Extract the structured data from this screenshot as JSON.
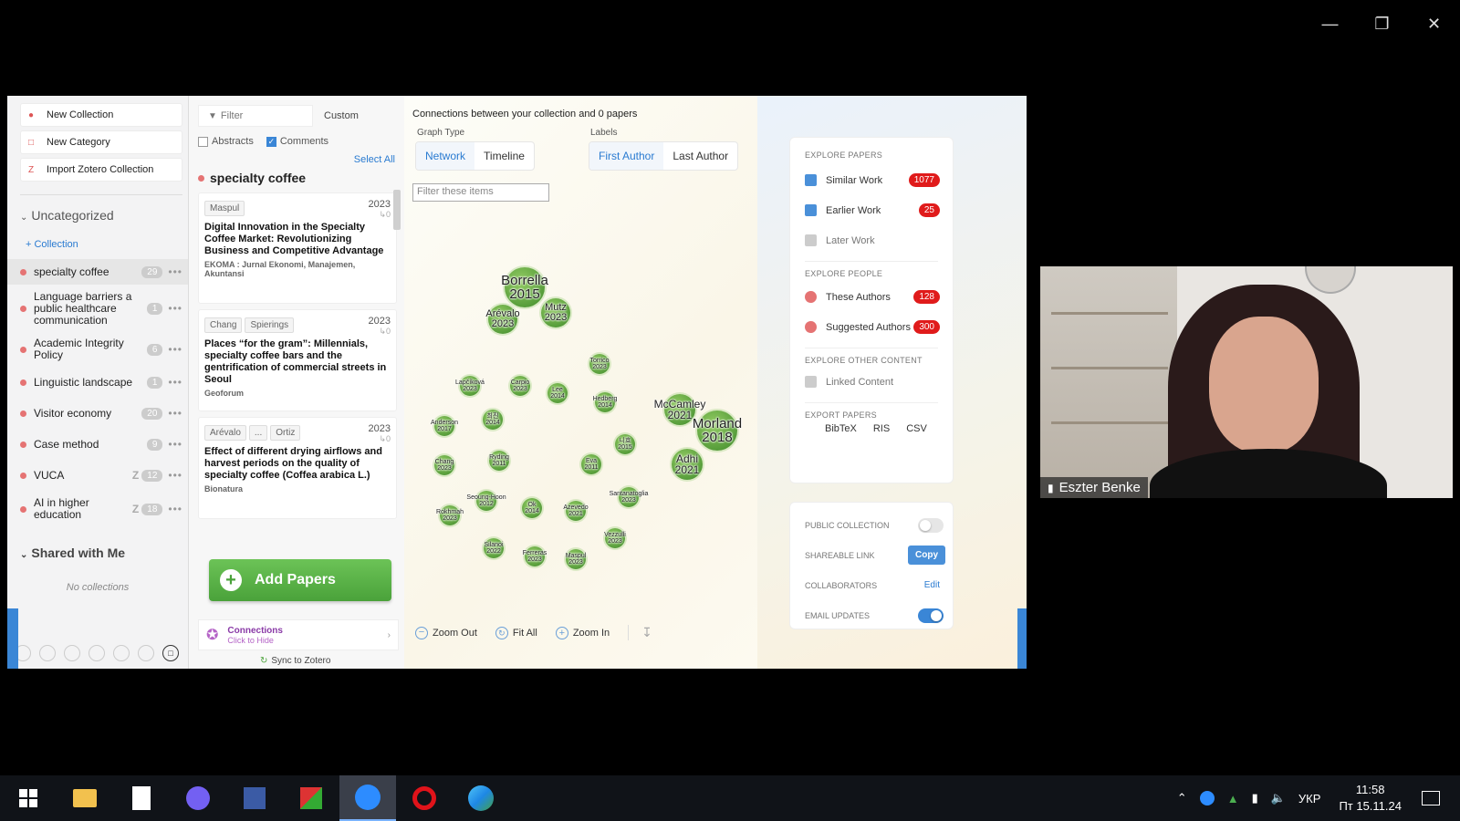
{
  "sidebar": {
    "buttons": [
      "New Collection",
      "New Category",
      "Import Zotero Collection"
    ],
    "uncategorized_label": "Uncategorized",
    "add_collection": "+ Collection",
    "collections": [
      {
        "name": "specialty coffee",
        "count": "29"
      },
      {
        "name": "Language barriers a public healthcare communication",
        "count": "1"
      },
      {
        "name": "Academic Integrity Policy",
        "count": "6"
      },
      {
        "name": "Linguistic landscape",
        "count": "1"
      },
      {
        "name": "Visitor economy",
        "count": "20"
      },
      {
        "name": "Case method",
        "count": "9"
      },
      {
        "name": "VUCA",
        "count": "12",
        "z": "Z"
      },
      {
        "name": "AI in higher education",
        "count": "18",
        "z": "Z"
      }
    ],
    "shared_label": "Shared with Me",
    "no_collections": "No collections"
  },
  "list": {
    "filter_placeholder": "Filter",
    "custom_label": "Custom",
    "abstracts_label": "Abstracts",
    "comments_label": "Comments",
    "select_all": "Select All",
    "collection_title": "specialty coffee",
    "papers": [
      {
        "tags": [
          "Maspul"
        ],
        "year": "2023",
        "cites": "↳0",
        "title": "Digital Innovation in the Specialty Coffee Market: Revolutionizing Business and Competitive Advantage",
        "journal": "EKOMA : Jurnal Ekonomi, Manajemen, Akuntansi"
      },
      {
        "tags": [
          "Chang",
          "Spierings"
        ],
        "year": "2023",
        "cites": "↳0",
        "title": "Places “for the gram”: Millennials, specialty coffee bars and the gentrification of commercial streets in Seoul",
        "journal": "Geoforum"
      },
      {
        "tags": [
          "Arévalo",
          "...",
          "Ortiz"
        ],
        "year": "2023",
        "cites": "↳0",
        "title": "Effect of different drying airflows and harvest periods on the quality of specialty coffee (Coffea arabica L.)",
        "journal": "Bionatura"
      }
    ],
    "add_papers": "Add Papers",
    "connections_title": "Connections",
    "connections_sub": "Click to Hide",
    "sync": "Sync to Zotero"
  },
  "graph": {
    "header": "Connections between your collection and 0 papers",
    "graph_type_label": "Graph Type",
    "graph_types": [
      "Network",
      "Timeline"
    ],
    "labels_label": "Labels",
    "label_types": [
      "First Author",
      "Last Author"
    ],
    "filter_placeholder": "Filter these items",
    "nodes": [
      {
        "name": "Borrella",
        "year": "2015",
        "size": "xl"
      },
      {
        "name": "Arévalo",
        "year": "2023",
        "size": "m"
      },
      {
        "name": "Mutz",
        "year": "2023",
        "size": "m"
      },
      {
        "name": "Torrico",
        "year": "2023",
        "size": "s"
      },
      {
        "name": "Lapčíková",
        "year": "2023",
        "size": "s"
      },
      {
        "name": "Carpio",
        "year": "2023",
        "size": "s"
      },
      {
        "name": "Lee",
        "year": "2014",
        "size": "s"
      },
      {
        "name": "Hedberg",
        "year": "2014",
        "size": "s"
      },
      {
        "name": "McCamley",
        "year": "2021",
        "size": "l"
      },
      {
        "name": "Morland",
        "year": "2018",
        "size": "xl"
      },
      {
        "name": "Anderson",
        "year": "2017",
        "size": "s"
      },
      {
        "name": "최진",
        "year": "2014",
        "size": "s"
      },
      {
        "name": "니흐",
        "year": "2015",
        "size": "s"
      },
      {
        "name": "Adhi",
        "year": "2021",
        "size": "l"
      },
      {
        "name": "Chang",
        "year": "2023",
        "size": "s"
      },
      {
        "name": "Ryding",
        "year": "2011",
        "size": "s"
      },
      {
        "name": "Eva",
        "year": "2011",
        "size": "s"
      },
      {
        "name": "Seoung-Hoon",
        "year": "2012",
        "size": "s"
      },
      {
        "name": "Ok",
        "year": "2014",
        "size": "s"
      },
      {
        "name": "Azevedo",
        "year": "2021",
        "size": "s"
      },
      {
        "name": "Santanatoglia",
        "year": "2023",
        "size": "s"
      },
      {
        "name": "Rokhmah",
        "year": "2023",
        "size": "s"
      },
      {
        "name": "Vezzulli",
        "year": "2023",
        "size": "s"
      },
      {
        "name": "Silanoi",
        "year": "2022",
        "size": "s"
      },
      {
        "name": "Ferreras",
        "year": "2023",
        "size": "s"
      },
      {
        "name": "Maspul",
        "year": "2023",
        "size": "s"
      }
    ],
    "zoom_out": "Zoom Out",
    "fit_all": "Fit All",
    "zoom_in": "Zoom In"
  },
  "right": {
    "explore_papers": "EXPLORE PAPERS",
    "similar_work": "Similar Work",
    "similar_count": "1077",
    "earlier_work": "Earlier Work",
    "earlier_count": "25",
    "later_work": "Later Work",
    "explore_people": "EXPLORE PEOPLE",
    "these_authors": "These Authors",
    "these_count": "128",
    "suggested_authors": "Suggested Authors",
    "suggested_count": "300",
    "explore_other": "EXPLORE OTHER CONTENT",
    "linked_content": "Linked Content",
    "export_papers": "EXPORT PAPERS",
    "export_formats": [
      "BibTeX",
      "RIS",
      "CSV"
    ],
    "public_collection": "PUBLIC COLLECTION",
    "shareable_link": "SHAREABLE LINK",
    "copy": "Copy",
    "collaborators": "COLLABORATORS",
    "edit": "Edit",
    "email_updates": "EMAIL UPDATES"
  },
  "video": {
    "participant": "Eszter Benke"
  },
  "taskbar": {
    "lang": "УКР",
    "time": "11:58",
    "date": "Пт 15.11.24"
  },
  "colors": {
    "accent": "#2a7bd1",
    "badge": "#e01b1b",
    "node": "#4a9a32",
    "add": "#5bb948"
  }
}
